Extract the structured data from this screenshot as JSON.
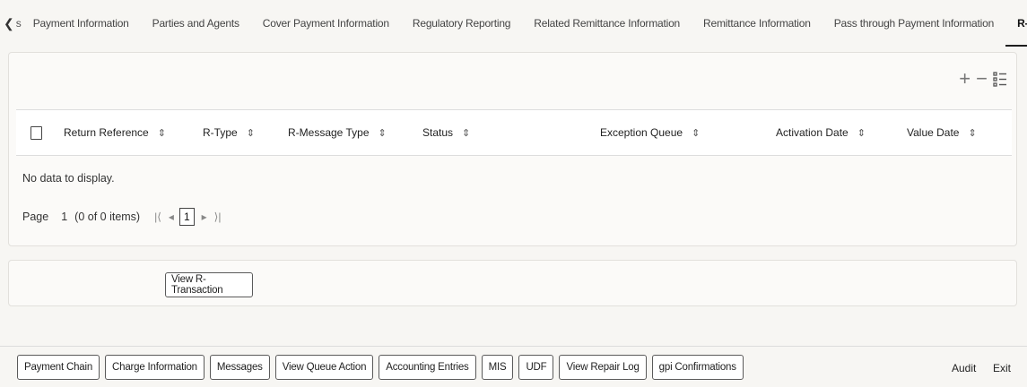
{
  "tabs": {
    "scroll_left_icon": "chevron-left-icon",
    "partial_label": "s",
    "items": [
      {
        "label": "Payment Information"
      },
      {
        "label": "Parties and Agents"
      },
      {
        "label": "Cover Payment Information"
      },
      {
        "label": "Regulatory Reporting"
      },
      {
        "label": "Related Remittance Information"
      },
      {
        "label": "Remittance Information"
      },
      {
        "label": "Pass through Payment Information"
      },
      {
        "label": "R-Transac"
      }
    ],
    "active_index": 7
  },
  "grid": {
    "toolbar_icons": [
      "add-icon",
      "remove-icon",
      "column-settings-icon"
    ],
    "columns": [
      {
        "label": "Return Reference"
      },
      {
        "label": "R-Type"
      },
      {
        "label": "R-Message Type"
      },
      {
        "label": "Status"
      },
      {
        "label": "Exception Queue"
      },
      {
        "label": "Activation Date"
      },
      {
        "label": "Value Date"
      }
    ],
    "empty_message": "No data to display.",
    "pager": {
      "page_label": "Page",
      "page_value": "1",
      "items_text": "(0 of 0 items)",
      "current_page": "1"
    }
  },
  "action": {
    "view_label": "View R-Transaction"
  },
  "footer": {
    "buttons": [
      {
        "label": "Payment Chain"
      },
      {
        "label": "Charge Information"
      },
      {
        "label": "Messages"
      },
      {
        "label": "View Queue Action"
      },
      {
        "label": "Accounting Entries"
      },
      {
        "label": "MIS"
      },
      {
        "label": "UDF"
      },
      {
        "label": "View Repair Log"
      },
      {
        "label": "gpi Confirmations"
      }
    ],
    "audit_label": "Audit",
    "exit_label": "Exit"
  }
}
